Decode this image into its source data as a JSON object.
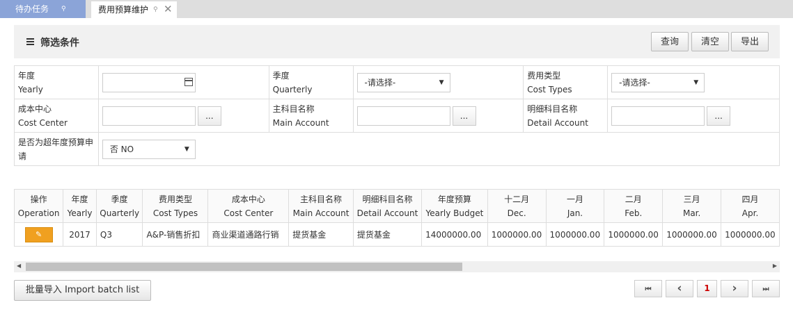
{
  "tabs": [
    {
      "label": "待办任务",
      "pin": "⚲"
    },
    {
      "label": "费用预算维护",
      "pin": "⚲",
      "close": "✕"
    }
  ],
  "filter": {
    "title": "筛选条件",
    "query_label": "查询",
    "clear_label": "清空",
    "export_label": "导出",
    "fields": {
      "yearly": {
        "cn": "年度",
        "en": "Yearly",
        "value": ""
      },
      "quarterly": {
        "cn": "季度",
        "en": "Quarterly",
        "value": "-请选择-"
      },
      "cost_types": {
        "cn": "费用类型",
        "en": "Cost Types",
        "value": "-请选择-"
      },
      "cost_center": {
        "cn": "成本中心",
        "en": "Cost Center",
        "value": ""
      },
      "main_account": {
        "cn": "主科目名称",
        "en": "Main Account",
        "value": ""
      },
      "detail_account": {
        "cn": "明细科目名称",
        "en": "Detail Account",
        "value": ""
      },
      "over_budget": {
        "cn": "是否为超年度预算申请",
        "value": "否 NO"
      }
    },
    "lookup_label": "..."
  },
  "grid": {
    "columns": [
      {
        "cn": "操作",
        "en": "Operation"
      },
      {
        "cn": "年度",
        "en": "Yearly"
      },
      {
        "cn": "季度",
        "en": "Quarterly"
      },
      {
        "cn": "费用类型",
        "en": "Cost Types"
      },
      {
        "cn": "成本中心",
        "en": "Cost Center"
      },
      {
        "cn": "主科目名称",
        "en": "Main Account"
      },
      {
        "cn": "明细科目名称",
        "en": "Detail Account"
      },
      {
        "cn": "年度预算",
        "en": "Yearly Budget"
      },
      {
        "cn": "十二月",
        "en": "Dec."
      },
      {
        "cn": "一月",
        "en": "Jan."
      },
      {
        "cn": "二月",
        "en": "Feb."
      },
      {
        "cn": "三月",
        "en": "Mar."
      },
      {
        "cn": "四月",
        "en": "Apr."
      }
    ],
    "rows": [
      {
        "edit_icon": "edit-icon",
        "edit_glyph": "✎",
        "cells": [
          "2017",
          "Q3",
          "A&P-销售折扣",
          "商业渠道通路行销",
          "提货基金",
          "提货基金",
          "14000000.00",
          "1000000.00",
          "1000000.00",
          "1000000.00",
          "1000000.00",
          "1000000.00"
        ]
      }
    ]
  },
  "import_label": "批量导入 Import batch list",
  "pager": {
    "first": "⏮",
    "prev": "‹",
    "page": "1",
    "next": "›",
    "last": "⏭"
  },
  "colors": {
    "tab_active": "#8ba4d8",
    "edit_button": "#f0a020",
    "page_current": "#cc0000"
  }
}
